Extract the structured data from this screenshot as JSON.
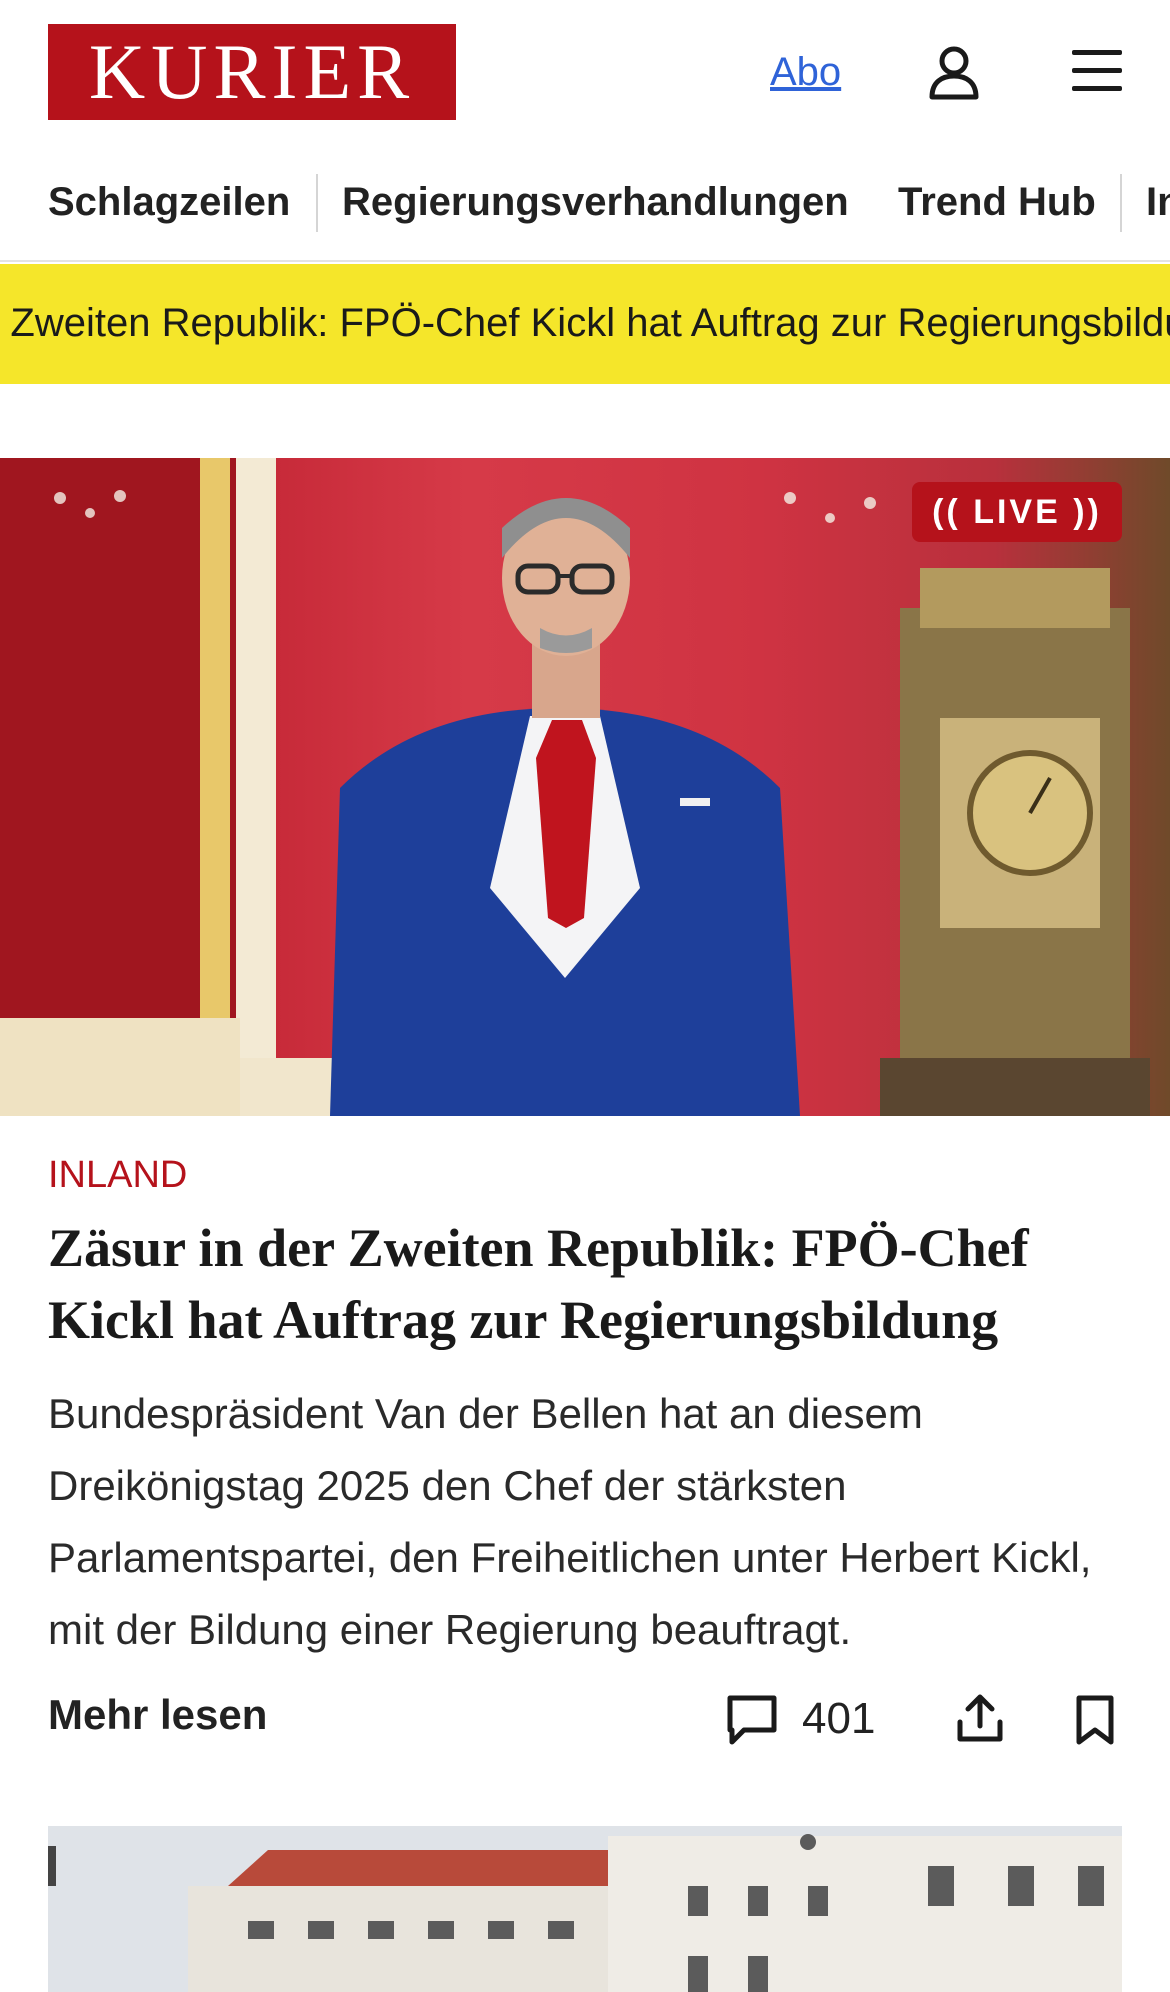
{
  "header": {
    "logo_text": "KURIER",
    "abo_label": "Abo",
    "user_icon": "user-icon",
    "menu_icon": "hamburger-menu-icon"
  },
  "nav": {
    "items": [
      {
        "label": "Schlagzeilen"
      },
      {
        "label": "Regierungsverhandlungen"
      },
      {
        "label": "Trend Hub"
      },
      {
        "label": "In"
      }
    ]
  },
  "ticker": {
    "text": "r Zweiten Republik: FPÖ-Chef Kickl hat Auftrag zur Regierungsbildung"
  },
  "hero": {
    "live_label": "(( LIVE ))"
  },
  "article": {
    "category": "INLAND",
    "headline": "Zäsur in der Zweiten Republik: FPÖ-Chef Kickl hat Auftrag zur Regierungsbildung",
    "teaser": "Bundespräsident Van der Bellen hat an diesem Dreikönigstag 2025 den Chef der stärksten Parlamentspartei, den Freiheitlichen unter Herbert Kickl, mit der Bildung einer Regierung beauftragt.",
    "more_label": "Mehr lesen",
    "comment_count": "401",
    "comment_icon": "comment-icon",
    "share_icon": "share-icon",
    "bookmark_icon": "bookmark-icon"
  },
  "colors": {
    "brand_red": "#b5121b",
    "ticker_yellow": "#f5e62a",
    "link_blue": "#2f63d8"
  }
}
